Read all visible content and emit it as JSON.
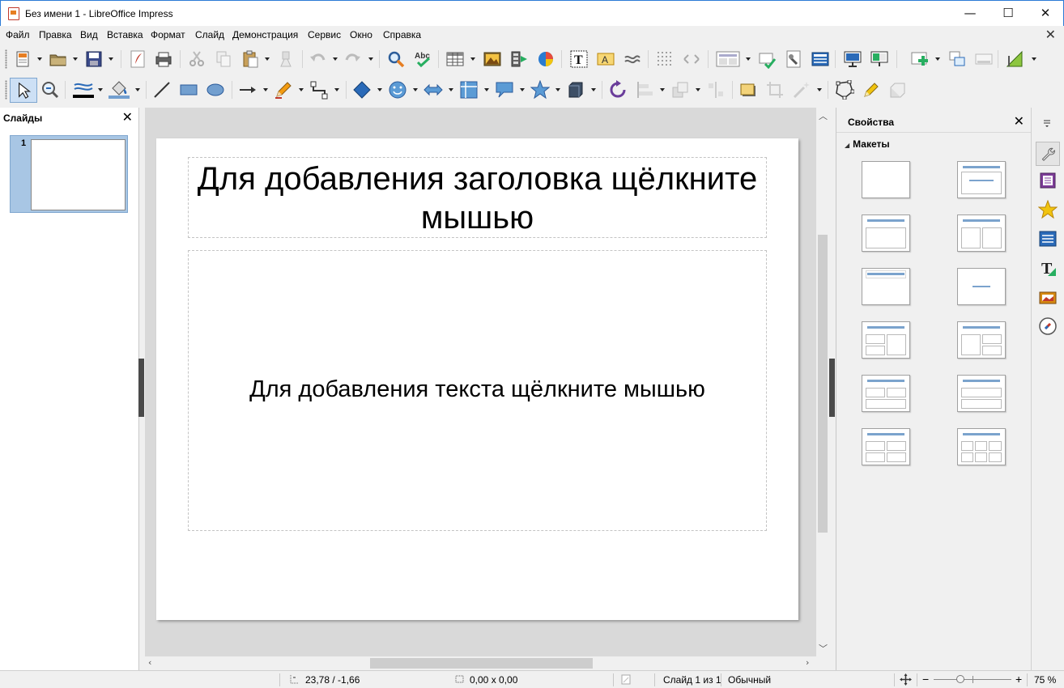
{
  "window": {
    "title": "Без имени 1 - LibreOffice Impress",
    "minimize": "—",
    "maximize": "☐",
    "close": "✕"
  },
  "menu": [
    "Файл",
    "Правка",
    "Вид",
    "Вставка",
    "Формат",
    "Слайд",
    "Демонстрация",
    "Сервис",
    "Окно",
    "Справка"
  ],
  "menu_close": "✕",
  "slides_panel": {
    "title": "Слайды",
    "close": "✕",
    "thumbs": [
      {
        "number": "1"
      }
    ]
  },
  "slide": {
    "title_placeholder": "Для добавления заголовка щёлкните мышью",
    "body_placeholder": "Для добавления текста щёлкните мышью"
  },
  "sidebar": {
    "title": "Свойства",
    "close": "✕",
    "section": "Макеты",
    "section_arrow": "◢"
  },
  "status": {
    "position": "23,78 / -1,66",
    "size": "0,00 x 0,00",
    "slide": "Слайд 1 из 1",
    "master": "Обычный",
    "zoom_minus": "−",
    "zoom_plus": "+",
    "zoom": "75 %"
  },
  "colors": {
    "accent": "#2b7bd6",
    "selection": "#a8c6e4",
    "layout_bar": "#7ba3cd"
  }
}
